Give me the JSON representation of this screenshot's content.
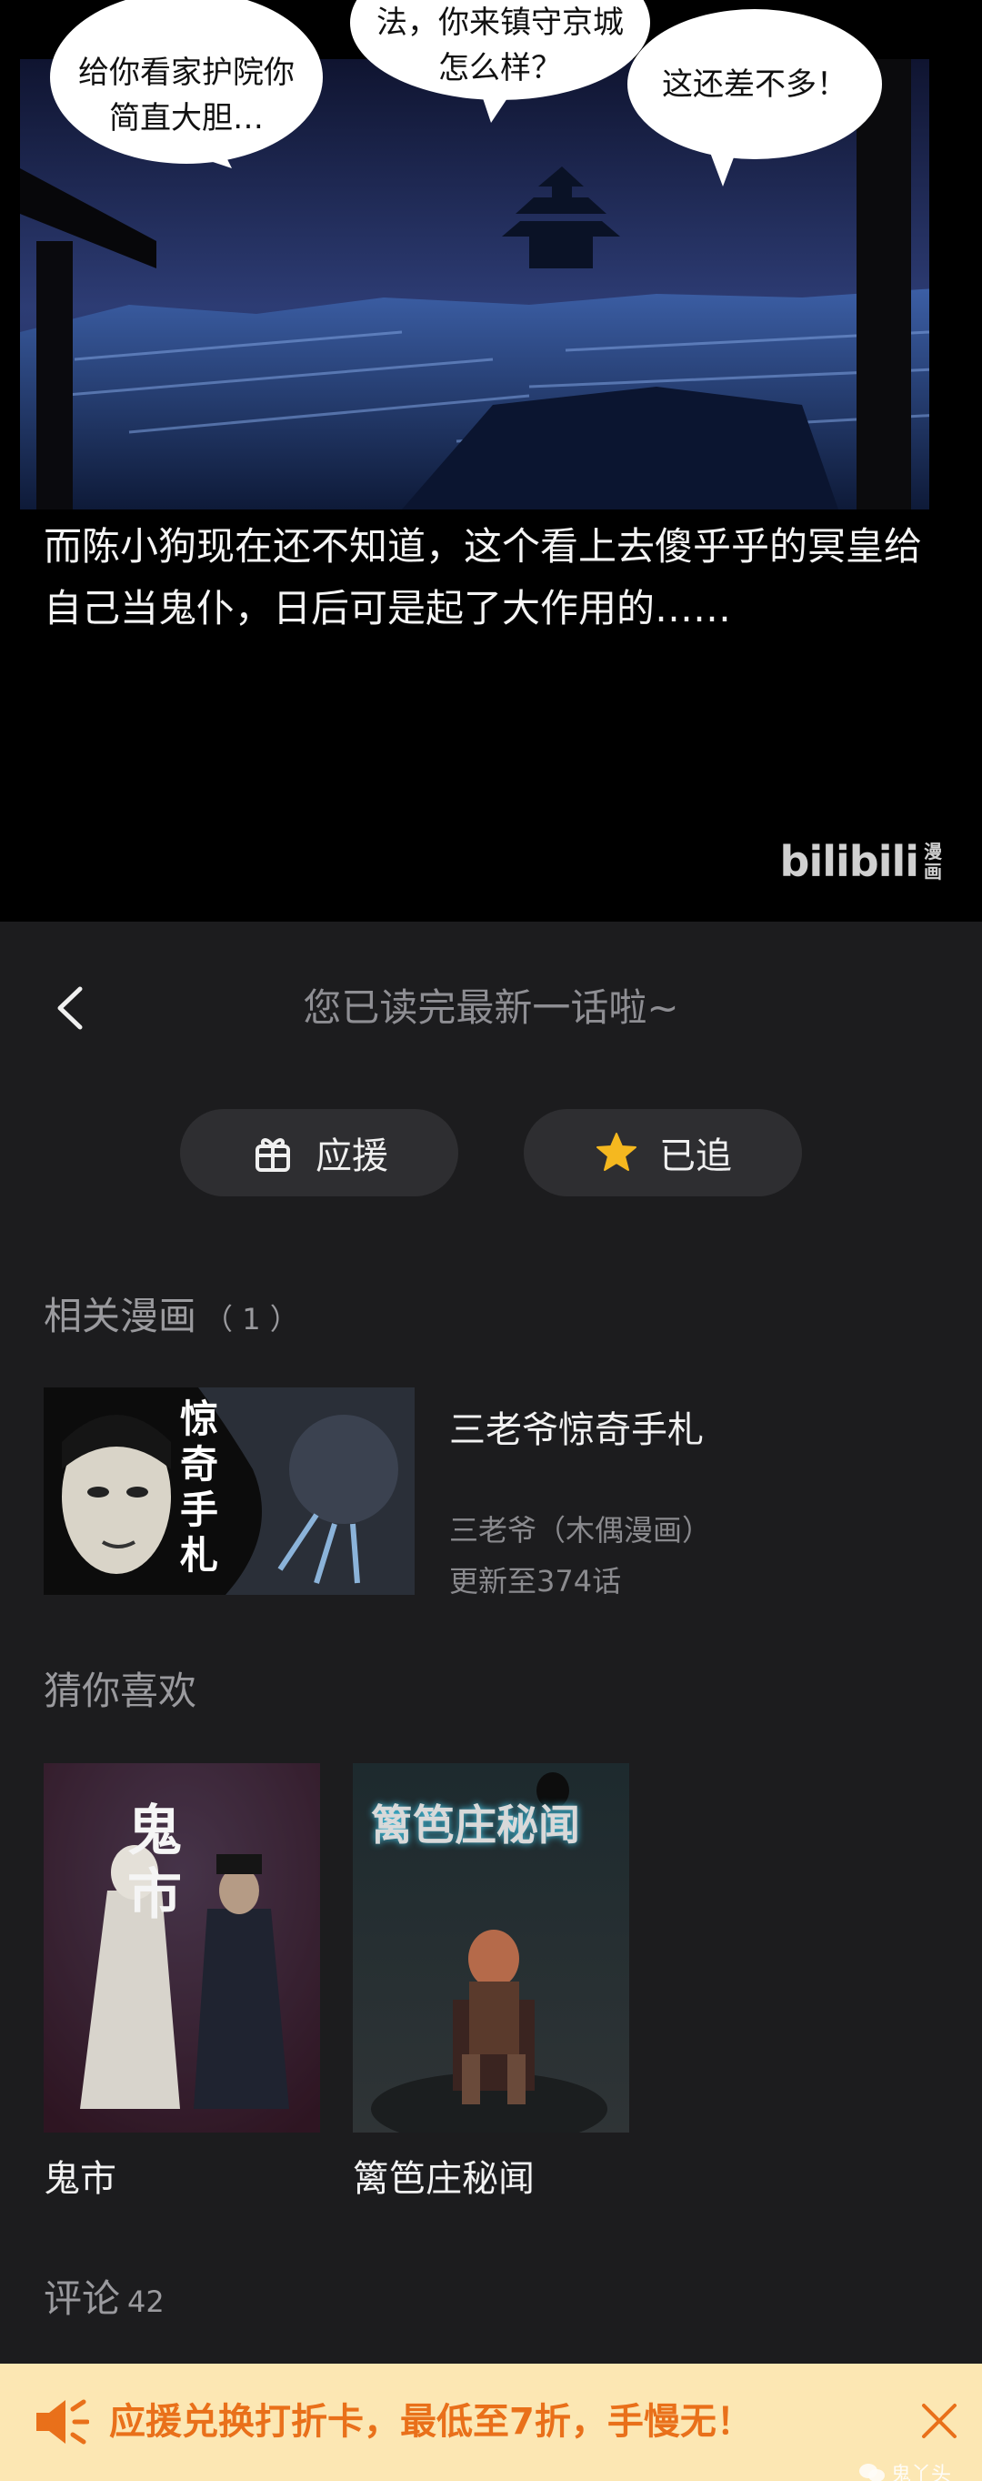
{
  "comic": {
    "bubbles": [
      [
        "给你看家护院你",
        "简直大胆…"
      ],
      [
        "法，你来镇守京城",
        "怎么样？"
      ],
      [
        "这还差不多！"
      ]
    ],
    "narration": "而陈小狗现在还不知道，这个看上去傻乎乎的冥皇给自己当鬼仆，日后可是起了大作用的……",
    "watermark": "bilibili",
    "watermark_sub": "漫画"
  },
  "end": {
    "title": "您已读完最新一话啦~",
    "back_icon": "chevron-left-icon",
    "support_label": "应援",
    "support_icon": "gift-icon",
    "follow_label": "已追",
    "follow_icon": "star-icon",
    "star_color": "#f5b81f"
  },
  "related": {
    "title": "相关漫画",
    "count": "（ 1 ）",
    "item": {
      "name": "三老爷惊奇手札",
      "cover_text": "惊奇手札",
      "author": "三老爷（木偶漫画）",
      "update": "更新至374话"
    }
  },
  "guess": {
    "title": "猜你喜欢",
    "items": [
      {
        "name": "鬼市",
        "cover_text": "鬼市"
      },
      {
        "name": "篱笆庄秘闻",
        "cover_text": "篱笆庄秘闻"
      }
    ]
  },
  "comments": {
    "title": "评论",
    "count": "42"
  },
  "banner": {
    "text": "应援兑换打折卡，最低至7折，手慢无！",
    "text_color": "#e9701a",
    "background": "#fce7b3",
    "speaker_icon": "speaker-icon",
    "close_icon": "close-icon",
    "watermark": "鬼丫头"
  }
}
